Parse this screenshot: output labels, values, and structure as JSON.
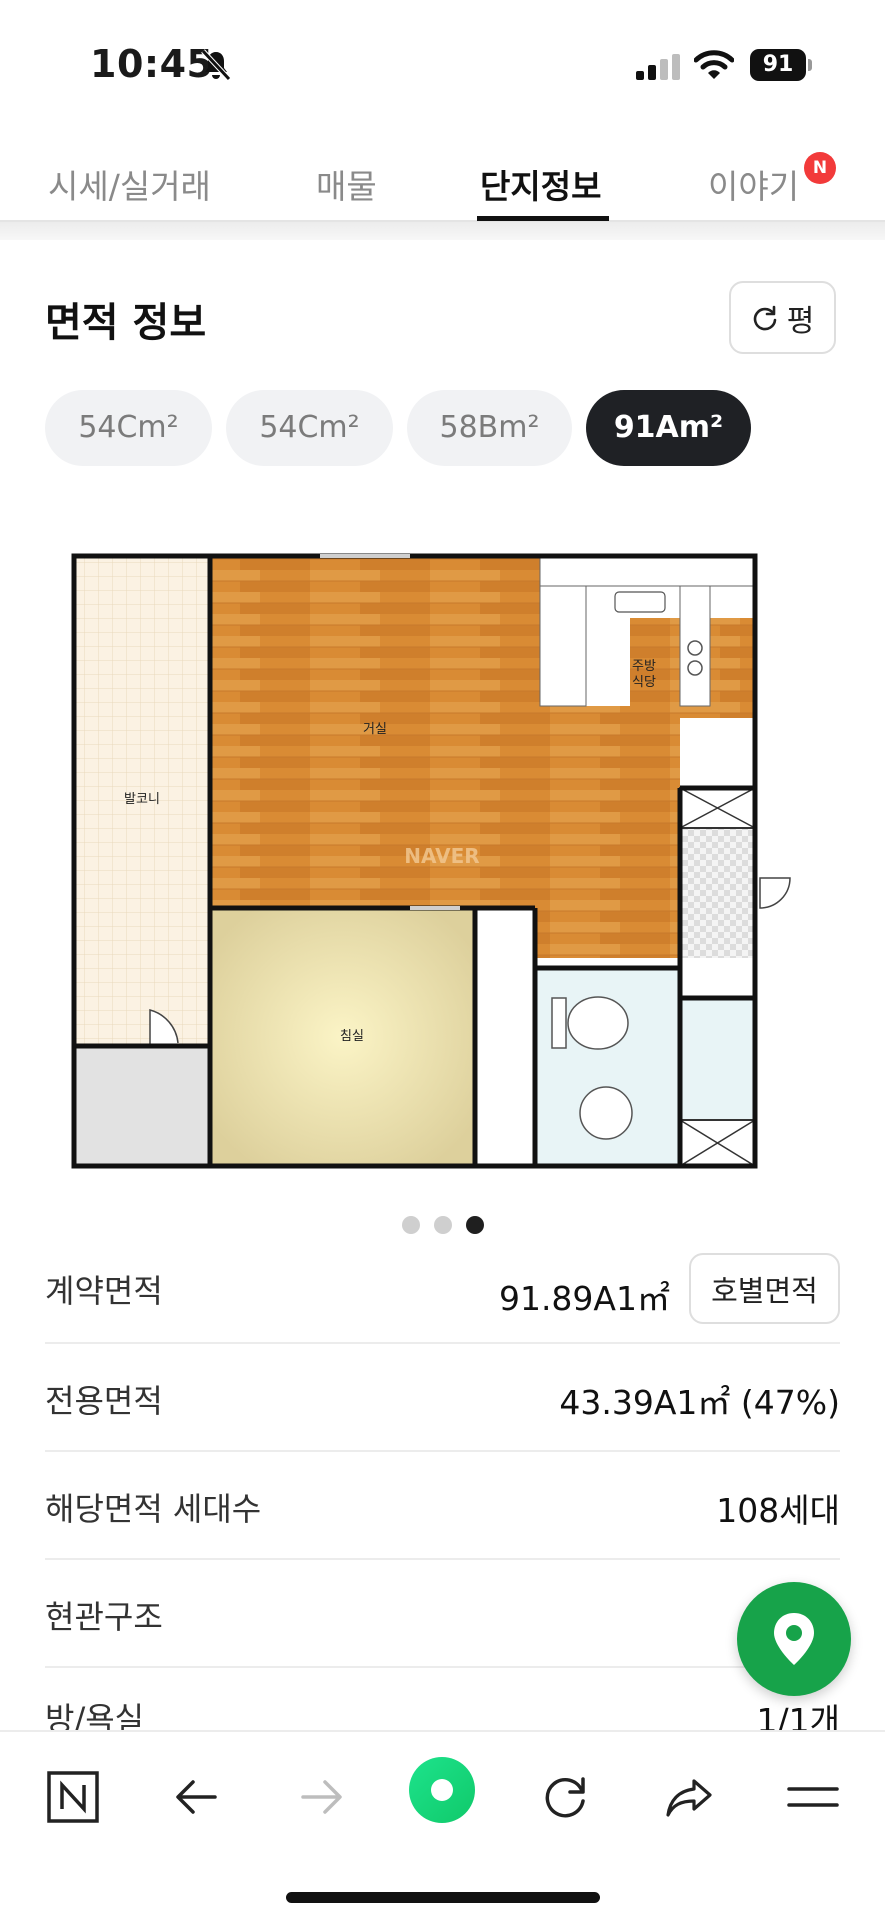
{
  "status_bar": {
    "time": "10:45",
    "battery": "91"
  },
  "tabs": [
    {
      "label": "시세/실거래",
      "active": false
    },
    {
      "label": "매물",
      "active": false
    },
    {
      "label": "단지정보",
      "active": true
    },
    {
      "label": "이야기",
      "active": false,
      "badge": "N"
    }
  ],
  "section": {
    "title": "면적 정보",
    "unit_button_label": "평",
    "unit_button_icon": "refresh-icon"
  },
  "area_chips": [
    {
      "label": "54Cm²",
      "active": false
    },
    {
      "label": "54Cm²",
      "active": false
    },
    {
      "label": "58Bm²",
      "active": false
    },
    {
      "label": "91Am²",
      "active": true
    }
  ],
  "floorplan": {
    "rooms": {
      "balcony": "발코니",
      "living": "거실",
      "kitchen_line1": "주방",
      "kitchen_line2": "식당",
      "bedroom": "침실"
    },
    "watermark": "NAVER"
  },
  "pager": {
    "count": 3,
    "active_index": 2
  },
  "info": {
    "contract_area": {
      "label": "계약면적",
      "value": "91.89A1㎡"
    },
    "detail_button": "호별면적",
    "exclusive_area": {
      "label": "전용면적",
      "value": "43.39A1㎡ (47%)"
    },
    "households": {
      "label": "해당면적 세대수",
      "value": "108세대"
    },
    "entrance": {
      "label": "현관구조",
      "value": ""
    },
    "rooms_baths": {
      "label": "방/욕실",
      "value": "1/1개"
    }
  },
  "colors": {
    "accent_green": "#17a34a",
    "badge_red": "#f23a3a",
    "active_chip": "#1f2125"
  }
}
